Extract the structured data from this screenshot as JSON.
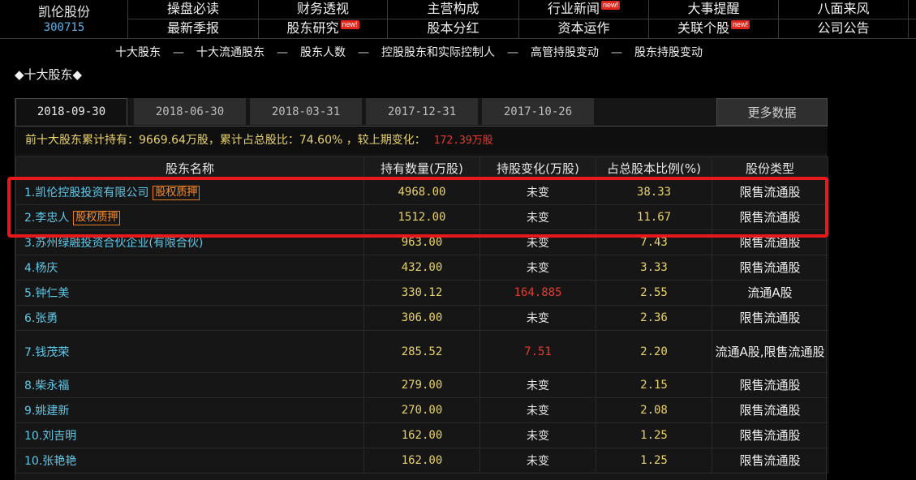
{
  "stock": {
    "name": "凯伦股份",
    "code": "300715"
  },
  "nav": {
    "row1": [
      {
        "label": "操盘必读",
        "new": ""
      },
      {
        "label": "财务透视",
        "new": ""
      },
      {
        "label": "主营构成",
        "new": ""
      },
      {
        "label": "行业新闻",
        "new": "new!"
      },
      {
        "label": "大事提醒",
        "new": ""
      },
      {
        "label": "八面来风",
        "new": ""
      }
    ],
    "row2": [
      {
        "label": "最新季报",
        "new": ""
      },
      {
        "label": "股东研究",
        "new": "new!"
      },
      {
        "label": "股本分红",
        "new": ""
      },
      {
        "label": "资本运作",
        "new": ""
      },
      {
        "label": "关联个股",
        "new": "new!"
      },
      {
        "label": "公司公告",
        "new": ""
      }
    ]
  },
  "subnav": {
    "items": [
      "十大股东",
      "十大流通股东",
      "股东人数",
      "控股股东和实际控制人",
      "高管持股变动",
      "股东持股变动"
    ],
    "separator": "—"
  },
  "section_title": "◆十大股东◆",
  "tabs": [
    "2018-09-30",
    "2018-06-30",
    "2018-03-31",
    "2017-12-31",
    "2017-10-26"
  ],
  "active_tab": "2018-09-30",
  "more_label": "更多数据",
  "summary": {
    "text": "前十大股东累计持有：9669.64万股，累计占总股比：74.60% ，较上期变化：",
    "change": "172.39万股"
  },
  "table": {
    "headers": [
      "股东名称",
      "持有数量(万股)",
      "持股变化(万股)",
      "占总股本比例(%)",
      "股份类型"
    ],
    "rows": [
      {
        "name": "1.凯伦控股投资有限公司",
        "tag": "股权质押",
        "hold": "4968.00",
        "change": "未变",
        "ratio": "38.33",
        "type": "限售流通股"
      },
      {
        "name": "2.李忠人",
        "tag": "股权质押",
        "hold": "1512.00",
        "change": "未变",
        "ratio": "11.67",
        "type": "限售流通股"
      },
      {
        "name": "3.苏州绿融投资合伙企业(有限合伙)",
        "tag": "",
        "hold": "963.00",
        "change": "未变",
        "ratio": "7.43",
        "type": "限售流通股"
      },
      {
        "name": "4.杨庆",
        "tag": "",
        "hold": "432.00",
        "change": "未变",
        "ratio": "3.33",
        "type": "限售流通股"
      },
      {
        "name": "5.钟仁美",
        "tag": "",
        "hold": "330.12",
        "change": "164.885",
        "ratio": "2.55",
        "type": "流通A股"
      },
      {
        "name": "6.张勇",
        "tag": "",
        "hold": "306.00",
        "change": "未变",
        "ratio": "2.36",
        "type": "限售流通股"
      },
      {
        "name": "7.钱茂荣",
        "tag": "",
        "hold": "285.52",
        "change": "7.51",
        "ratio": "2.20",
        "type": "流通A股,限售流通股"
      },
      {
        "name": "8.柴永福",
        "tag": "",
        "hold": "279.00",
        "change": "未变",
        "ratio": "2.15",
        "type": "限售流通股"
      },
      {
        "name": "9.姚建新",
        "tag": "",
        "hold": "270.00",
        "change": "未变",
        "ratio": "2.08",
        "type": "限售流通股"
      },
      {
        "name": "10.刘吉明",
        "tag": "",
        "hold": "162.00",
        "change": "未变",
        "ratio": "1.25",
        "type": "限售流通股"
      },
      {
        "name": "10.张艳艳",
        "tag": "",
        "hold": "162.00",
        "change": "未变",
        "ratio": "1.25",
        "type": "限售流通股"
      }
    ]
  },
  "colors": {
    "background": "#000000",
    "accent_yellow": "#e8d26a",
    "link_cyan": "#5fc8e8",
    "up_red": "#e53b2f",
    "highlight_red": "#e8191b",
    "pledge_orange": "#ff8c2a"
  }
}
